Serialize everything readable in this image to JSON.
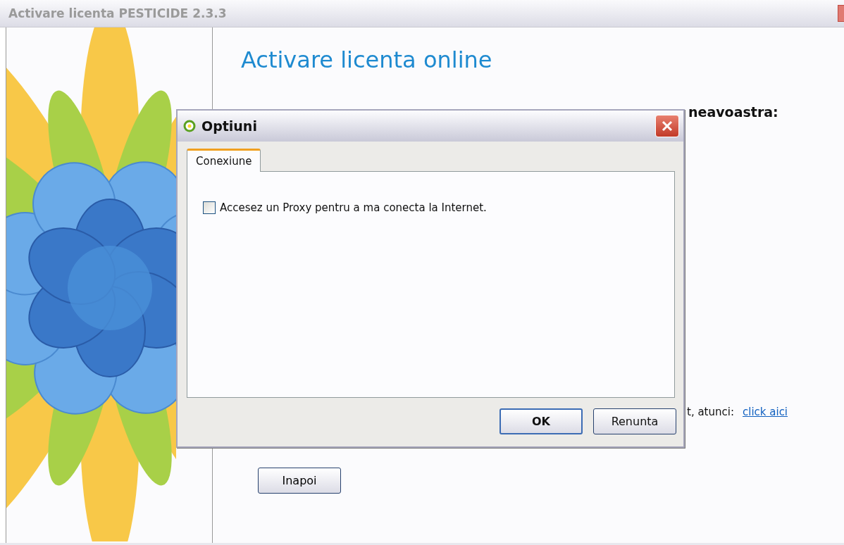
{
  "window": {
    "title": "Activare licenta PESTICIDE 2.3.3"
  },
  "page": {
    "heading": "Activare licenta online",
    "instruction_visible": "neavoastra:",
    "proxy_hint_visible": "t, atunci:",
    "link": "click aici",
    "back_button": "Inapoi"
  },
  "dialog": {
    "title": "Optiuni",
    "tabs": [
      {
        "label": "Conexiune",
        "selected": true
      }
    ],
    "options": [
      {
        "label": "Accesez un Proxy pentru a ma conecta la Internet.",
        "checked": false
      }
    ],
    "buttons": [
      {
        "label": "OK",
        "default": true
      },
      {
        "label": "Renunta",
        "default": false
      }
    ]
  }
}
